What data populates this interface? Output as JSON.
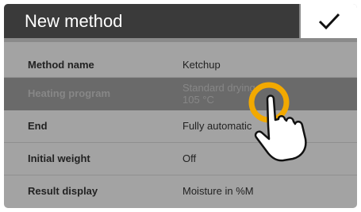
{
  "window": {
    "title": "New method",
    "confirm_icon": "checkmark-icon"
  },
  "rows": [
    {
      "label": "Method name",
      "value_line1": "Ketchup",
      "value_line2": ""
    },
    {
      "label": "Heating program",
      "value_line1": "Standard drying",
      "value_line2": "105 °C"
    },
    {
      "label": "End",
      "value_line1": "Fully automatic",
      "value_line2": ""
    },
    {
      "label": "Initial weight",
      "value_line1": "Off",
      "value_line2": ""
    },
    {
      "label": "Result display",
      "value_line1": "Moisture in %M",
      "value_line2": ""
    }
  ],
  "selected_row": "Heating program",
  "colors": {
    "titlebar": "#3a3a3a",
    "background": "#a3a3a3",
    "selected_row": "#6a6a6a",
    "touch_ring": "#f2a900"
  },
  "overlay": {
    "icon": "tap-hand-icon"
  }
}
